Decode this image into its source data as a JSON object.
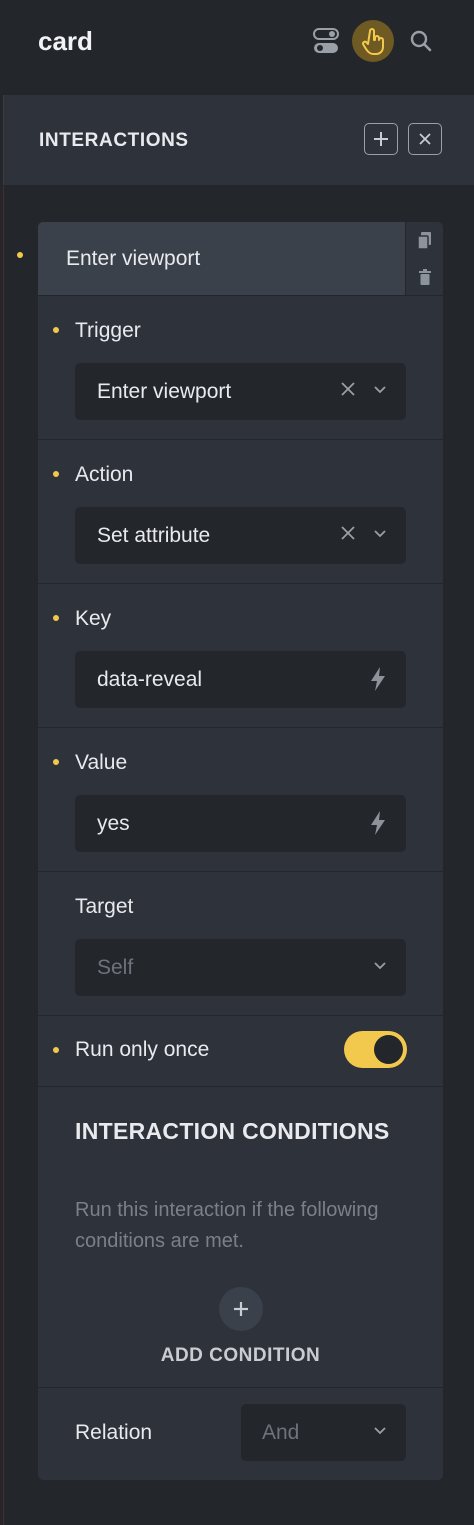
{
  "topbar": {
    "title": "card",
    "icons": [
      "toggle-icon",
      "pointer-hand-icon",
      "search-icon"
    ],
    "active_color": "#6e5a22"
  },
  "panel": {
    "title": "INTERACTIONS",
    "actions": [
      "plus-icon",
      "close-icon"
    ]
  },
  "interaction": {
    "header_label": "Enter viewport",
    "tools": [
      "copy-icon",
      "trash-icon"
    ],
    "fields": {
      "trigger": {
        "label": "Trigger",
        "value": "Enter viewport"
      },
      "action": {
        "label": "Action",
        "value": "Set attribute"
      },
      "key": {
        "label": "Key",
        "value": "data-reveal"
      },
      "value": {
        "label": "Value",
        "value": "yes"
      },
      "target": {
        "label": "Target",
        "placeholder": "Self"
      },
      "run_once": {
        "label": "Run only once",
        "enabled": true
      }
    },
    "conditions": {
      "title": "INTERACTION CONDITIONS",
      "description": "Run this interaction if the following conditions are met.",
      "add_label": "ADD CONDITION"
    },
    "relation": {
      "label": "Relation",
      "placeholder": "And"
    }
  },
  "colors": {
    "accent": "#f2c94c",
    "background": "#23262b",
    "card": "#2e323a"
  }
}
